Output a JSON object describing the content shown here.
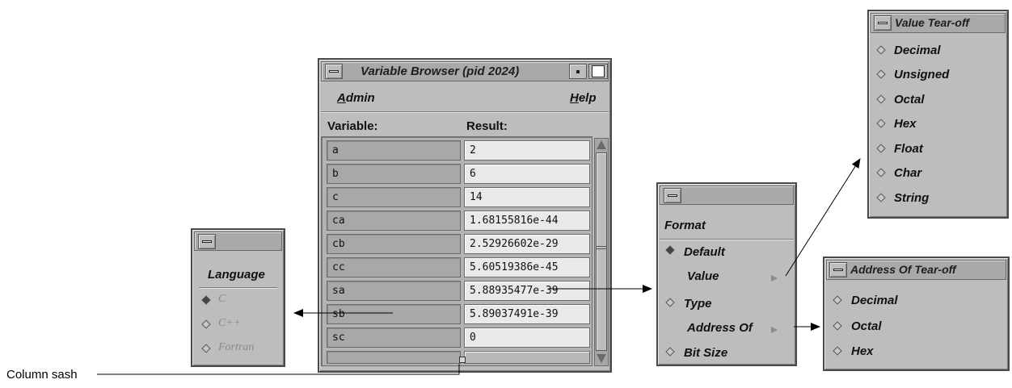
{
  "variable_browser": {
    "title": "Variable Browser (pid 2024)",
    "menu": {
      "admin_first": "A",
      "admin_rest": "dmin",
      "help_first": "H",
      "help_rest": "elp"
    },
    "headers": {
      "variable": "Variable:",
      "result": "Result:"
    },
    "rows": [
      {
        "var": "a",
        "result": "2"
      },
      {
        "var": "b",
        "result": "6"
      },
      {
        "var": "c",
        "result": "14"
      },
      {
        "var": "ca",
        "result": "1.68155816e-44"
      },
      {
        "var": "cb",
        "result": "2.52926602e-29"
      },
      {
        "var": "cc",
        "result": "5.60519386e-45"
      },
      {
        "var": "sa",
        "result": "5.88935477e-39"
      },
      {
        "var": "sb",
        "result": "5.89037491e-39"
      },
      {
        "var": "sc",
        "result": "0"
      }
    ]
  },
  "language_menu": {
    "title": "Language",
    "items": [
      "C",
      "C++",
      "Fortran"
    ],
    "selected": "C"
  },
  "format_menu": {
    "title": "Format",
    "items": [
      "Default",
      "Value",
      "Type",
      "Address Of",
      "Bit Size"
    ],
    "selected": "Default"
  },
  "value_tearoff": {
    "title": "Value Tear-off",
    "items": [
      "Decimal",
      "Unsigned",
      "Octal",
      "Hex",
      "Float",
      "Char",
      "String"
    ]
  },
  "address_tearoff": {
    "title": "Address Of Tear-off",
    "items": [
      "Decimal",
      "Octal",
      "Hex"
    ]
  },
  "callouts": {
    "column_sash": "Column sash"
  },
  "colors": {
    "window_bg": "#bdbdbd",
    "title_bg": "#a9a9a9",
    "variable_cell": "#a8a8a8",
    "result_cell": "#e9e9e9"
  }
}
